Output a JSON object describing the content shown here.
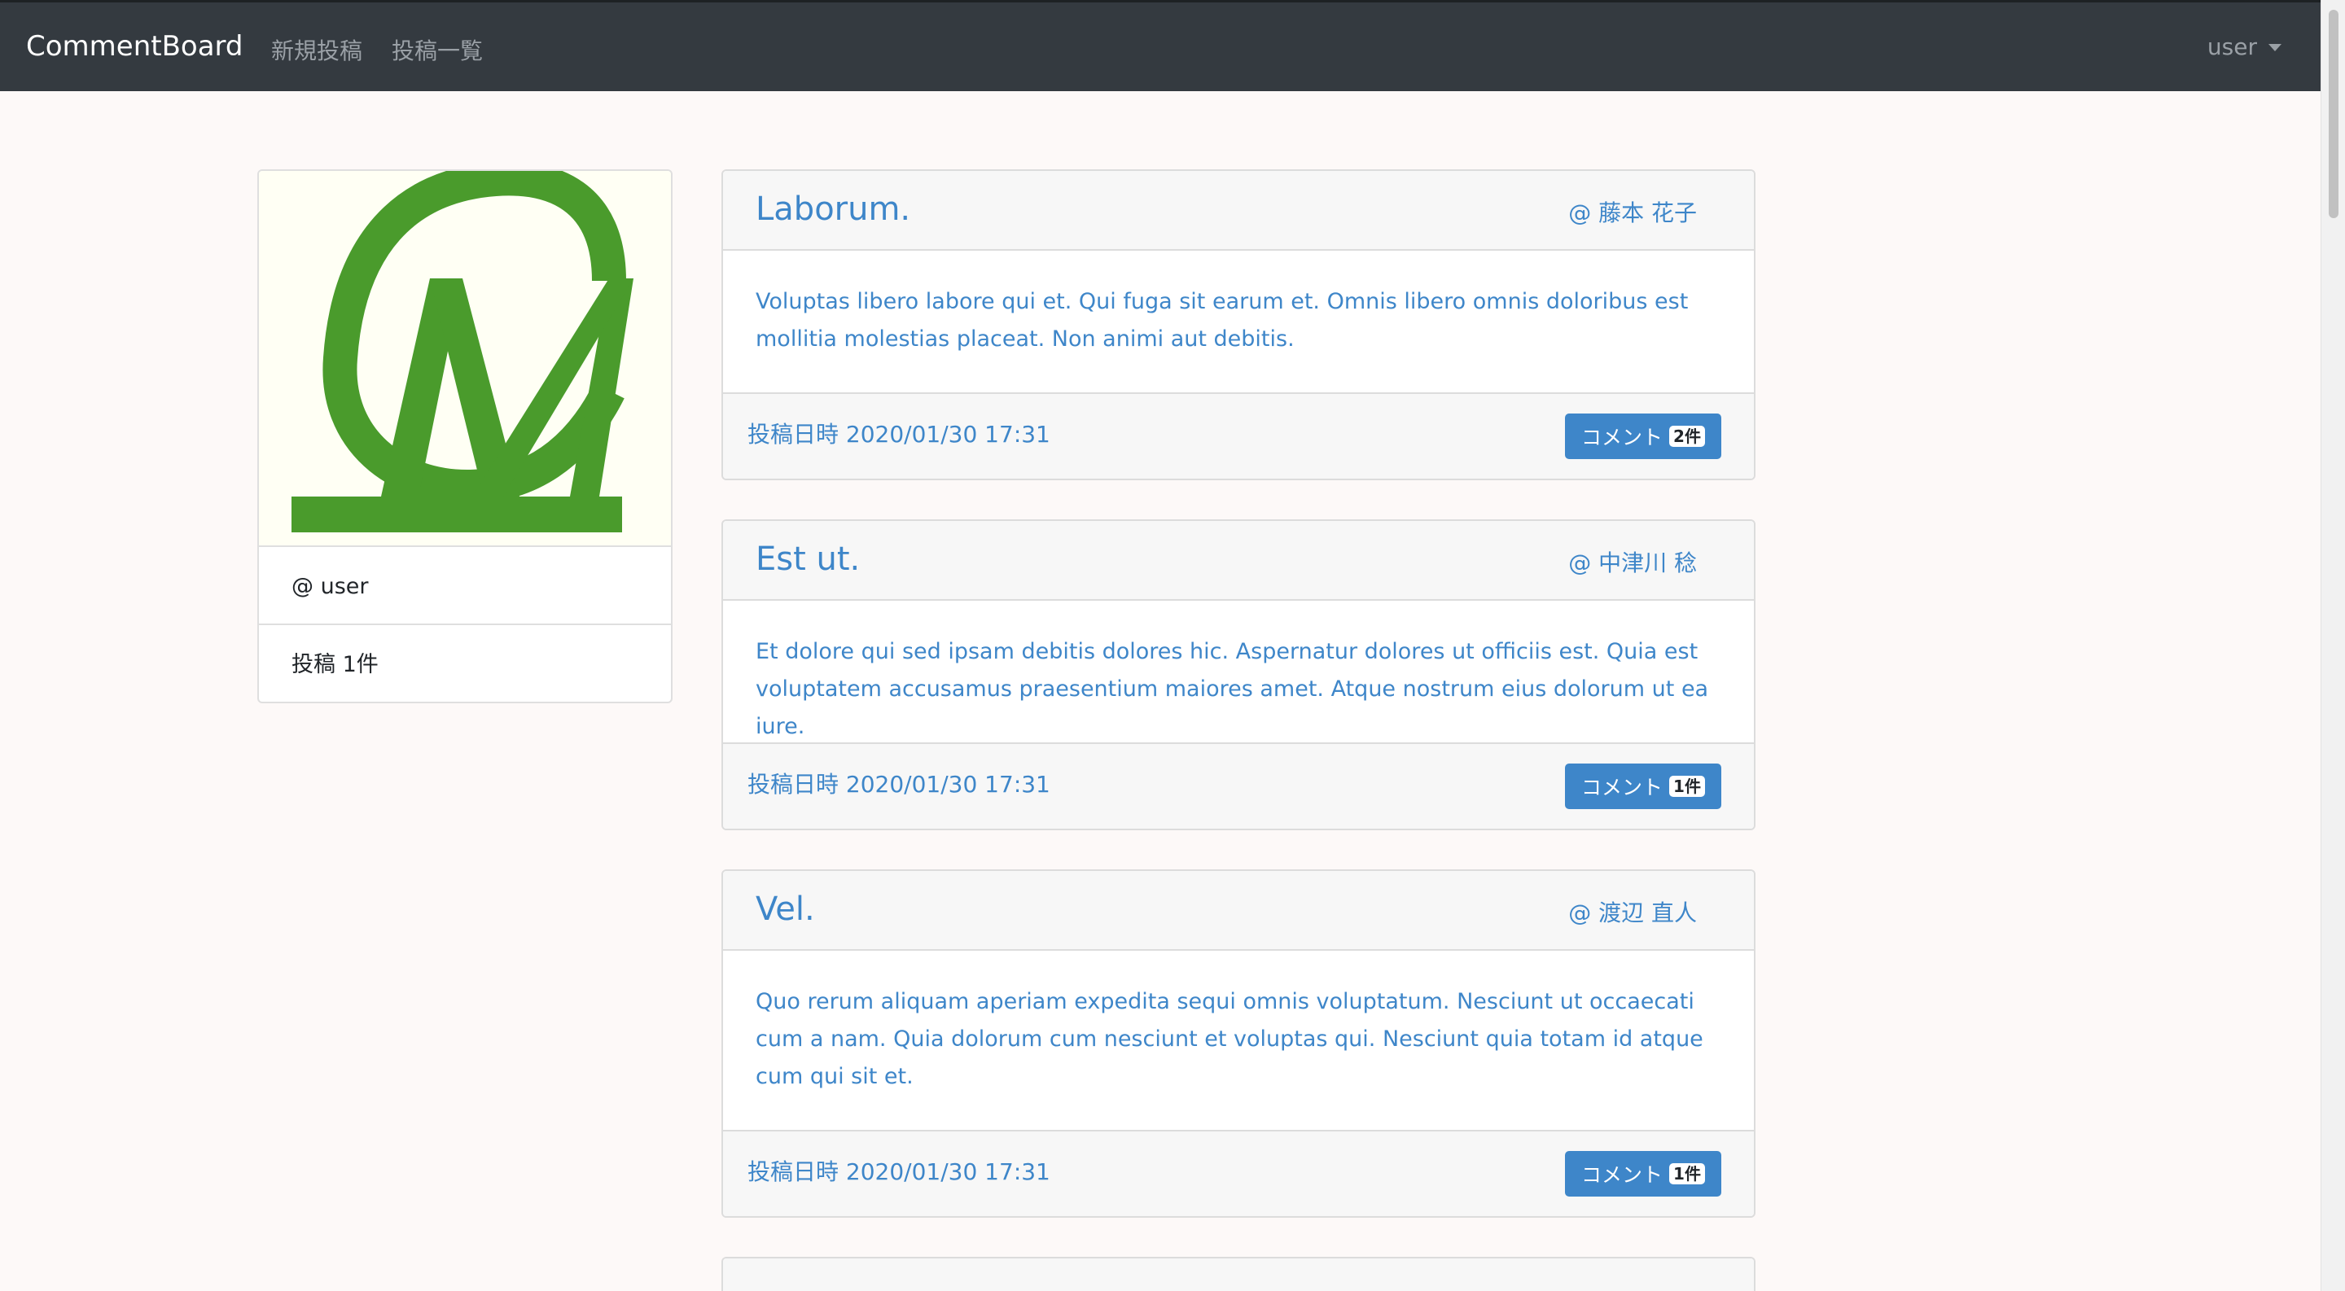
{
  "navbar": {
    "brand": "CommentBoard",
    "new_post": "新規投稿",
    "post_list": "投稿一覧",
    "user_menu": "user"
  },
  "profile": {
    "username": "@ user",
    "post_count": "投稿 1件",
    "avatar_color": "#4a9b2c"
  },
  "posts": [
    {
      "title": "Laborum.",
      "author": "@ 藤本 花子",
      "body": "Voluptas libero labore qui et. Qui fuga sit earum et. Omnis libero omnis doloribus est mollitia molestias placeat. Non animi aut debitis.",
      "date": "投稿日時 2020/01/30 17:31",
      "comment_label": "コメント",
      "comment_count": "2件"
    },
    {
      "title": "Est ut.",
      "author": "@ 中津川 稔",
      "body": "Et dolore qui sed ipsam debitis dolores hic. Aspernatur dolores ut officiis est. Quia est voluptatem accusamus praesentium maiores amet. Atque nostrum eius dolorum ut ea iure.",
      "date": "投稿日時 2020/01/30 17:31",
      "comment_label": "コメント",
      "comment_count": "1件"
    },
    {
      "title": "Vel.",
      "author": "@ 渡辺 直人",
      "body": "Quo rerum aliquam aperiam expedita sequi omnis voluptatum. Nesciunt ut occaecati cum a nam. Quia dolorum cum nesciunt et voluptas qui. Nesciunt quia totam id atque cum qui sit et.",
      "date": "投稿日時 2020/01/30 17:31",
      "comment_label": "コメント",
      "comment_count": "1件"
    }
  ],
  "colors": {
    "accent": "#3e86c9",
    "navbar": "#343a40"
  }
}
